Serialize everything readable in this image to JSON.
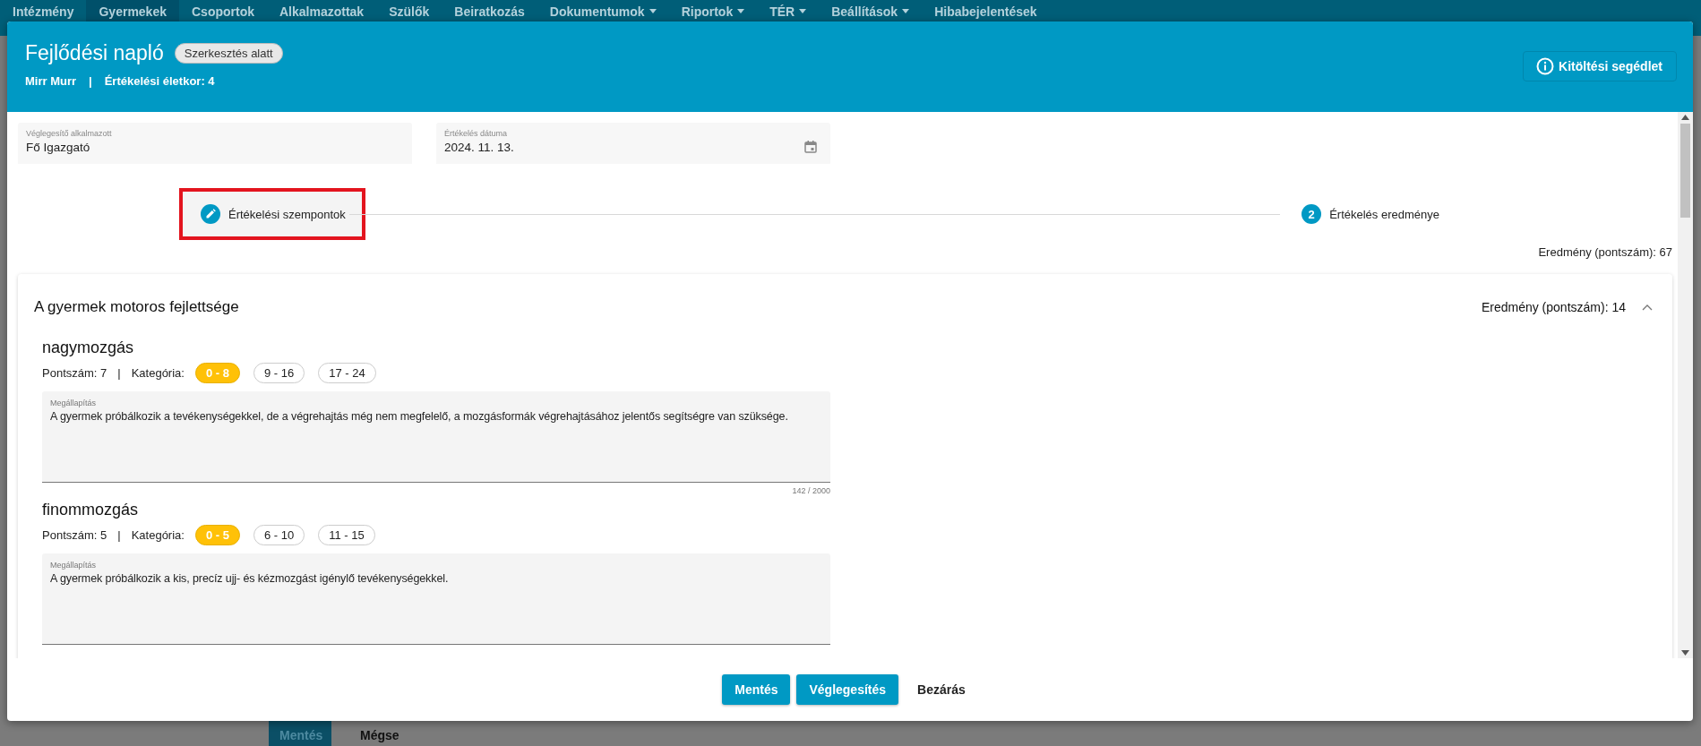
{
  "nav": [
    {
      "label": "Intézmény",
      "selected": false,
      "dropdown": false
    },
    {
      "label": "Gyermekek",
      "selected": true,
      "dropdown": false
    },
    {
      "label": "Csoportok",
      "selected": false,
      "dropdown": false
    },
    {
      "label": "Alkalmazottak",
      "selected": false,
      "dropdown": false
    },
    {
      "label": "Szülők",
      "selected": false,
      "dropdown": false
    },
    {
      "label": "Beiratkozás",
      "selected": false,
      "dropdown": false
    },
    {
      "label": "Dokumentumok",
      "selected": false,
      "dropdown": true
    },
    {
      "label": "Riportok",
      "selected": false,
      "dropdown": true
    },
    {
      "label": "TÉR",
      "selected": false,
      "dropdown": true
    },
    {
      "label": "Beállítások",
      "selected": false,
      "dropdown": true
    },
    {
      "label": "Hibabejelentések",
      "selected": false,
      "dropdown": false
    }
  ],
  "background_buttons": [
    {
      "label": "Mentés",
      "kind": "primary"
    },
    {
      "label": "Mégse",
      "kind": "text"
    }
  ],
  "modal": {
    "title": "Fejlődési napló",
    "status_badge": "Szerkesztés alatt",
    "subtitle": [
      {
        "text": "Mirr Murr"
      },
      {
        "text": "|"
      },
      {
        "text": "Értékelési életkor: 4"
      }
    ],
    "help_button": "Kitöltési segédlet",
    "fields": [
      {
        "kind": "text",
        "label": "Véglegesítő alkalmazott",
        "value": "Fő Igazgató"
      },
      {
        "kind": "date",
        "label": "Értékelés dátuma",
        "value": "2024. 11. 13."
      }
    ],
    "steps": [
      {
        "kind": "edit",
        "label": "Értékelési szempontok",
        "highlighted": true
      },
      {
        "kind": "number",
        "number": "2",
        "label": "Értékelés eredménye",
        "highlighted": false
      }
    ],
    "total_result": "Eredmény (pontszám): 67",
    "sections": [
      {
        "title": "A gyermek motoros fejlettsége",
        "result": "Eredmény (pontszám): 14",
        "expanded": true,
        "items": [
          {
            "name": "nagymozgás",
            "score": "Pontszám: 7",
            "separator": "|",
            "category_label": "Kategória:",
            "categories": [
              {
                "label": "0 - 8",
                "selected": true
              },
              {
                "label": "9 - 16",
                "selected": false
              },
              {
                "label": "17 - 24",
                "selected": false
              }
            ],
            "finding": {
              "label": "Megállapítás",
              "value": "A gyermek próbálkozik a tevékenységekkel, de a végrehajtás még nem megfelelő, a mozgásformák végrehajtásához jelentős segítségre van szüksége."
            },
            "counter": "142 / 2000"
          },
          {
            "name": "finommozgás",
            "score": "Pontszám: 5",
            "separator": "|",
            "category_label": "Kategória:",
            "categories": [
              {
                "label": "0 - 5",
                "selected": true
              },
              {
                "label": "6 - 10",
                "selected": false
              },
              {
                "label": "11 - 15",
                "selected": false
              }
            ],
            "finding": {
              "label": "Megállapítás",
              "value": "A gyermek próbálkozik a kis, precíz ujj- és kézmozgást igénylő tevékenységekkel."
            }
          }
        ]
      }
    ]
  },
  "footer_buttons": [
    {
      "label": "Mentés",
      "kind": "primary"
    },
    {
      "label": "Véglegesítés",
      "kind": "primary"
    },
    {
      "label": "Bezárás",
      "kind": "text"
    }
  ]
}
